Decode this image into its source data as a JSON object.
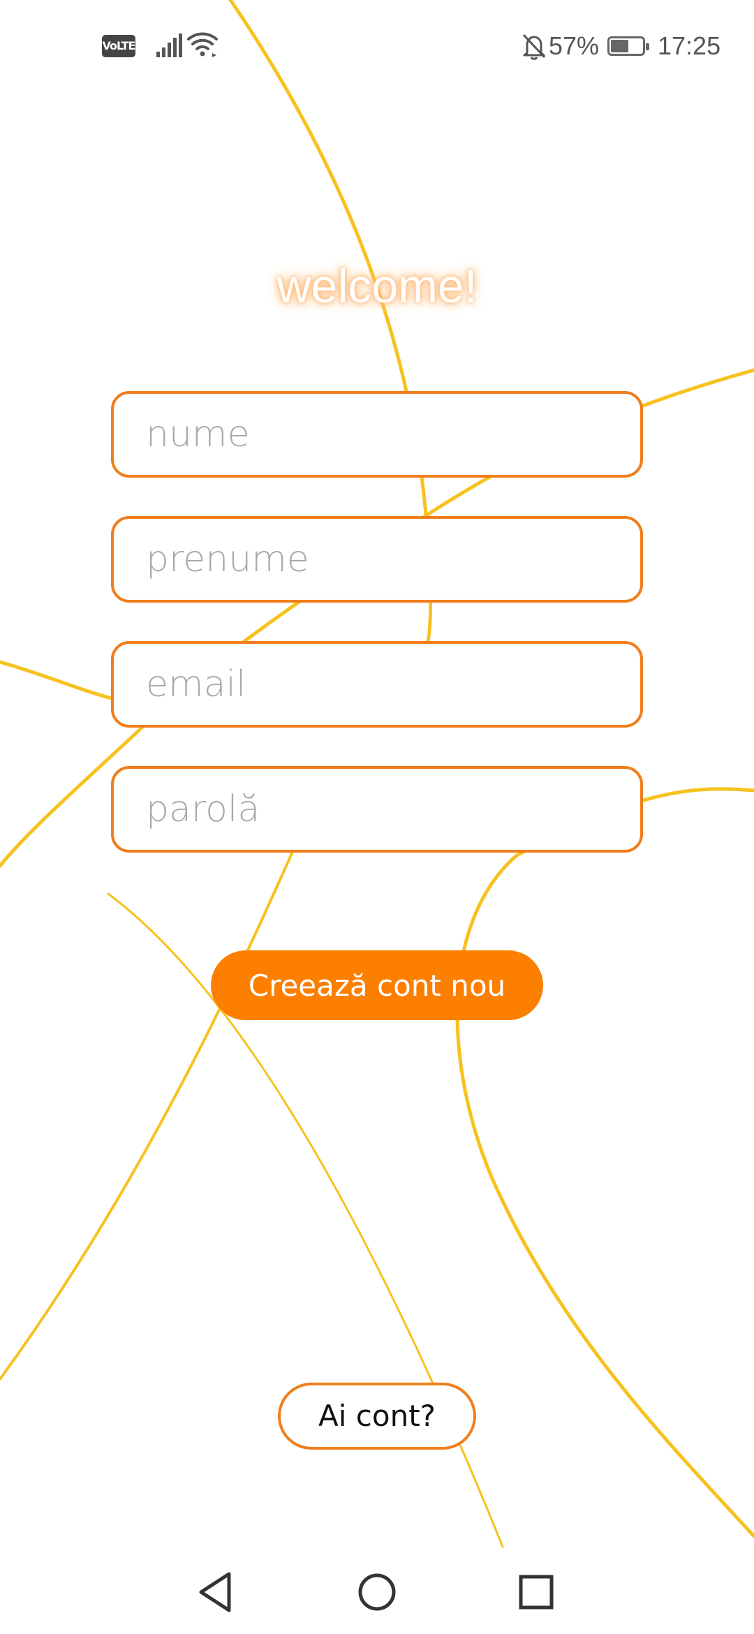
{
  "status_bar": {
    "volte": "VoLTE",
    "battery_percent": "57%",
    "battery_level": 0.57,
    "time": "17:25",
    "icons": [
      "volte-icon",
      "signal-icon",
      "wifi-icon",
      "bell-muted-icon",
      "battery-icon"
    ]
  },
  "title": "welcome!",
  "form": {
    "fields": [
      {
        "placeholder": "nume",
        "value": ""
      },
      {
        "placeholder": "prenume",
        "value": ""
      },
      {
        "placeholder": "email",
        "value": ""
      },
      {
        "placeholder": "parolă",
        "value": ""
      }
    ],
    "submit_label": "Creează cont nou",
    "login_label": "Ai cont?"
  },
  "nav_bar": {
    "icons": [
      "back-triangle-icon",
      "home-circle-icon",
      "recent-square-icon"
    ]
  },
  "colors": {
    "accent": "#fc7f00",
    "field_border": "#f07e1c",
    "background_lines": "#f7c21f",
    "placeholder": "#aaaaaa"
  }
}
